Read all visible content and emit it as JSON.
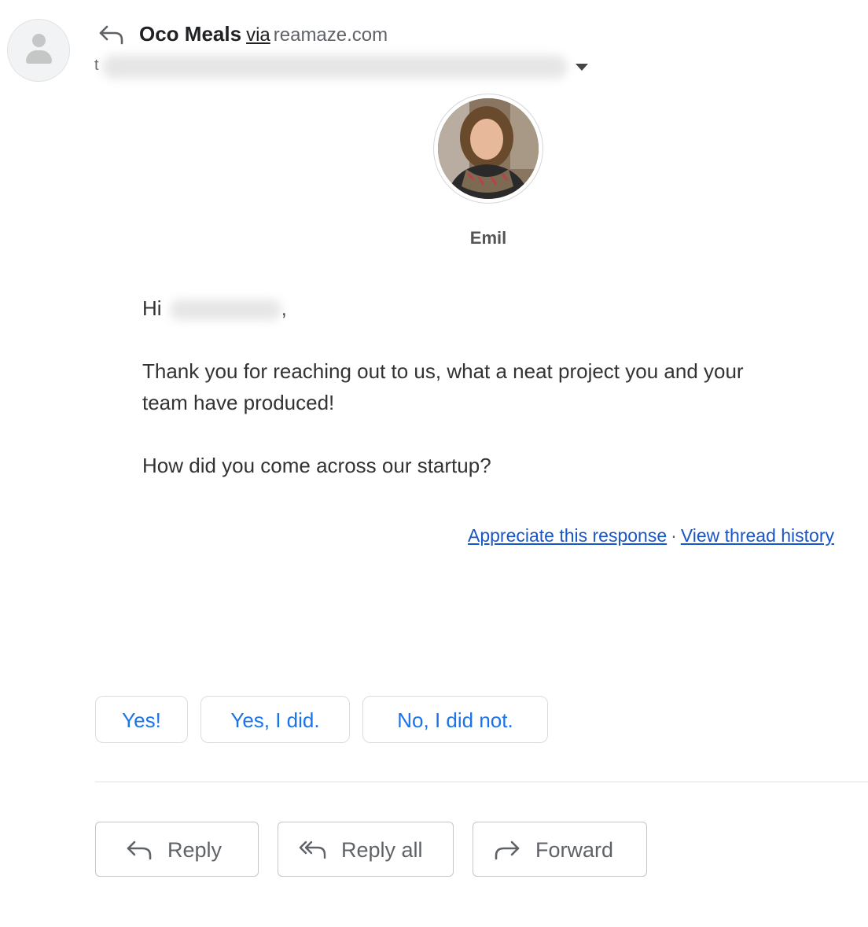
{
  "header": {
    "sender_name": "Oco Meals",
    "via_label": "via",
    "domain": "reamaze.com",
    "recipient_prefix": "t"
  },
  "agent": {
    "name": "Emil"
  },
  "message": {
    "greeting_prefix": "Hi",
    "greeting_suffix": ",",
    "line1": "Thank you for reaching out to us, what a neat project you and your",
    "line2": "team have produced!",
    "line3": "How did you come across our startup?"
  },
  "links": {
    "appreciate": "Appreciate this response",
    "separator": "·",
    "history": "View thread history"
  },
  "smart_replies": [
    "Yes!",
    "Yes, I did.",
    "No, I did not."
  ],
  "actions": {
    "reply": "Reply",
    "reply_all": "Reply all",
    "forward": "Forward"
  },
  "colors": {
    "link": "#1a57c6",
    "chip_text": "#1a73e8",
    "action_text": "#5f6368"
  }
}
